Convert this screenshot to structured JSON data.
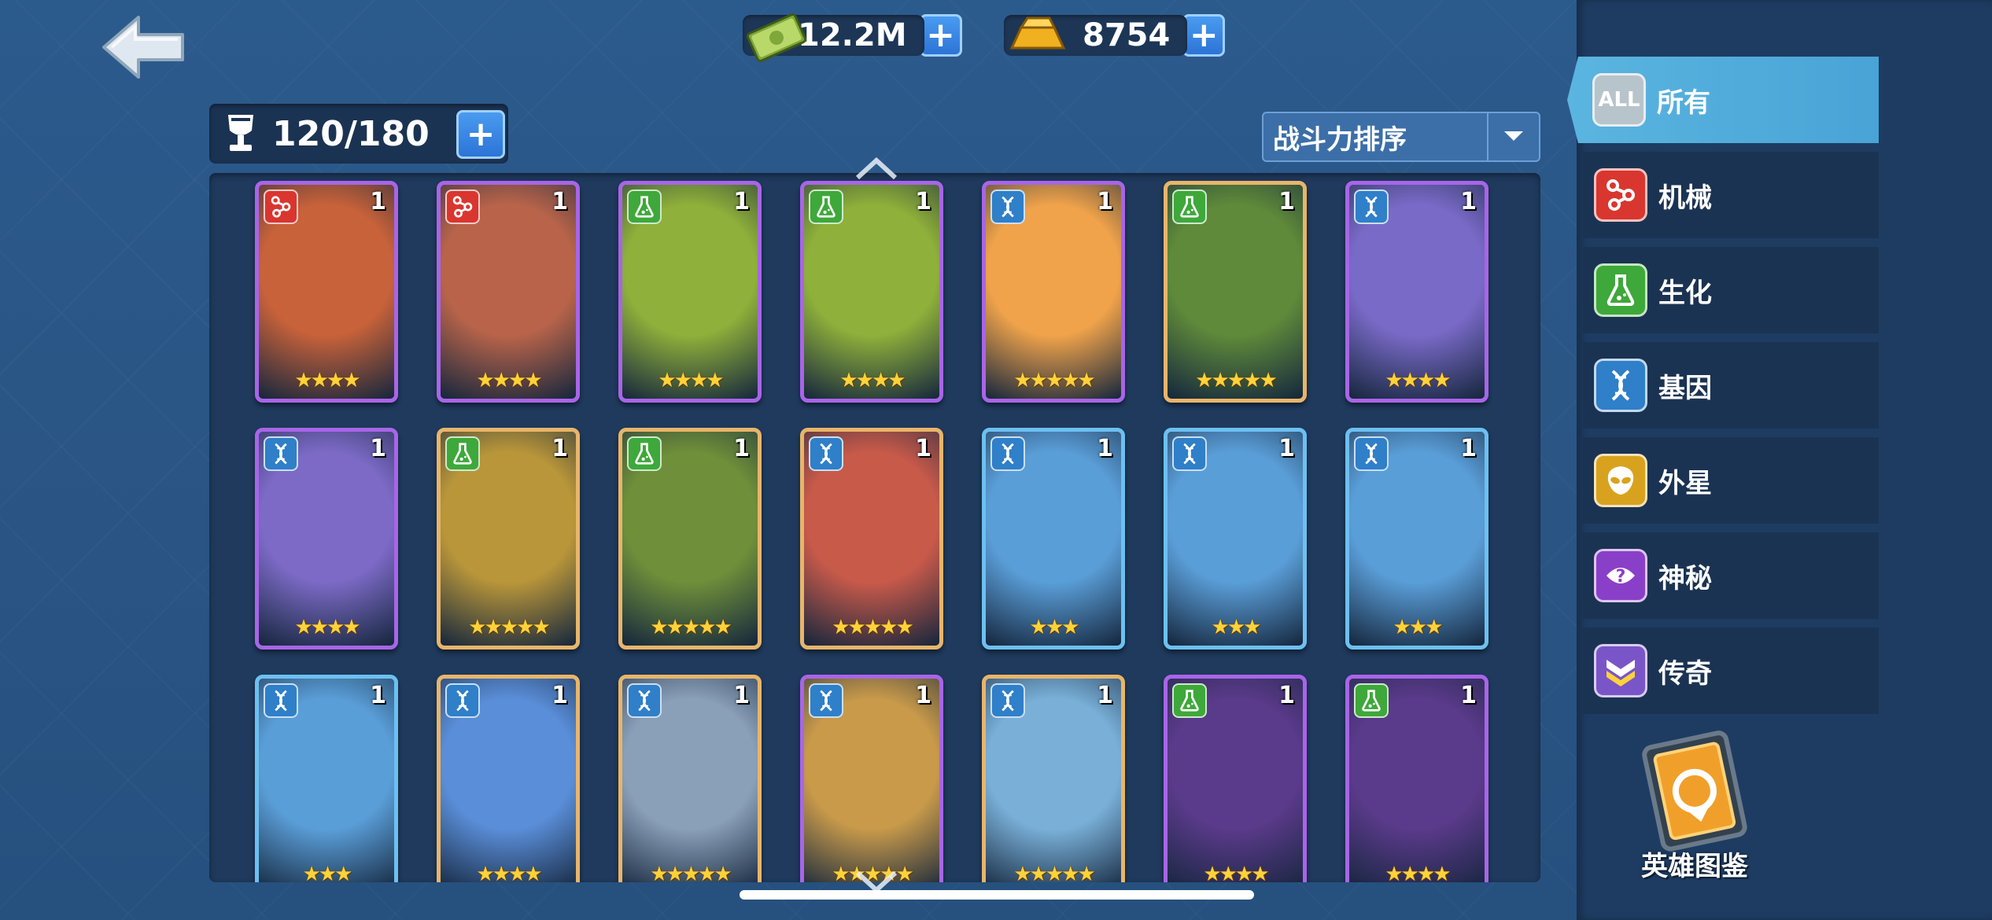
{
  "currency": {
    "cash": "12.2M",
    "gold": "8754"
  },
  "roster": {
    "count": "120/180"
  },
  "sort": {
    "selected": "战斗力排序"
  },
  "sidebar": {
    "tabs": [
      {
        "icon_text": "ALL",
        "label": "所有",
        "icon": "all-icon",
        "color": "#b8c4cc",
        "active": true
      },
      {
        "icon_text": "",
        "label": "机械",
        "icon": "mechanical-icon",
        "color": "#d9362f",
        "active": false
      },
      {
        "icon_text": "",
        "label": "生化",
        "icon": "biochem-flask-icon",
        "color": "#3ea83a",
        "active": false
      },
      {
        "icon_text": "",
        "label": "基因",
        "icon": "dna-icon",
        "color": "#2f7fc9",
        "active": false
      },
      {
        "icon_text": "",
        "label": "外星",
        "icon": "alien-head-icon",
        "color": "#d9a21e",
        "active": false
      },
      {
        "icon_text": "",
        "label": "神秘",
        "icon": "mystery-question-icon",
        "color": "#8a3fc8",
        "active": false
      },
      {
        "icon_text": "",
        "label": "传奇",
        "icon": "legendary-chevron-icon",
        "color": "#7a55c8",
        "active": false
      }
    ]
  },
  "codex": {
    "label": "英雄图鉴"
  },
  "cards": [
    {
      "faction": "mechanical-icon",
      "level": "1",
      "stars": "★★★★",
      "rarity": "purple",
      "art": "#c8623a"
    },
    {
      "faction": "mechanical-icon",
      "level": "1",
      "stars": "★★★★",
      "rarity": "purple",
      "art": "#b9644a"
    },
    {
      "faction": "biochem-flask-icon",
      "level": "1",
      "stars": "★★★★",
      "rarity": "purple",
      "art": "#8fb03a"
    },
    {
      "faction": "biochem-flask-icon",
      "level": "1",
      "stars": "★★★★",
      "rarity": "purple",
      "art": "#8fb03a"
    },
    {
      "faction": "dna-icon",
      "level": "1",
      "stars": "★★★★★",
      "rarity": "purple",
      "art": "#f0a34a"
    },
    {
      "faction": "biochem-flask-icon",
      "level": "1",
      "stars": "★★★★★",
      "rarity": "orange",
      "art": "#5f8a3a"
    },
    {
      "faction": "dna-icon",
      "level": "1",
      "stars": "★★★★",
      "rarity": "purple",
      "art": "#7a6ac8"
    },
    {
      "faction": "dna-icon",
      "level": "1",
      "stars": "★★★★",
      "rarity": "purple",
      "art": "#7c6ac6"
    },
    {
      "faction": "biochem-flask-icon",
      "level": "1",
      "stars": "★★★★★",
      "rarity": "orange",
      "art": "#b9963a"
    },
    {
      "faction": "biochem-flask-icon",
      "level": "1",
      "stars": "★★★★★",
      "rarity": "orange",
      "art": "#6f8f3a"
    },
    {
      "faction": "dna-icon",
      "level": "1",
      "stars": "★★★★★",
      "rarity": "orange",
      "art": "#c85a4a"
    },
    {
      "faction": "dna-icon",
      "level": "1",
      "stars": "★★★",
      "rarity": "blue",
      "art": "#5a9ed8"
    },
    {
      "faction": "dna-icon",
      "level": "1",
      "stars": "★★★",
      "rarity": "blue",
      "art": "#5a9ed8"
    },
    {
      "faction": "dna-icon",
      "level": "1",
      "stars": "★★★",
      "rarity": "blue",
      "art": "#5a9ed8"
    },
    {
      "faction": "dna-icon",
      "level": "1",
      "stars": "★★★",
      "rarity": "blue",
      "art": "#5a9ed8"
    },
    {
      "faction": "dna-icon",
      "level": "1",
      "stars": "★★★★",
      "rarity": "orange",
      "art": "#5a8ed8"
    },
    {
      "faction": "dna-icon",
      "level": "1",
      "stars": "★★★★★",
      "rarity": "orange",
      "art": "#8aa0b8"
    },
    {
      "faction": "dna-icon",
      "level": "1",
      "stars": "★★★★★",
      "rarity": "purple",
      "art": "#c89a4a"
    },
    {
      "faction": "dna-icon",
      "level": "1",
      "stars": "★★★★★",
      "rarity": "orange",
      "art": "#7ab0d8"
    },
    {
      "faction": "biochem-flask-icon",
      "level": "1",
      "stars": "★★★★",
      "rarity": "purple",
      "art": "#5a3a8a"
    },
    {
      "faction": "biochem-flask-icon",
      "level": "1",
      "stars": "★★★★",
      "rarity": "purple",
      "art": "#5a3a8a"
    }
  ]
}
